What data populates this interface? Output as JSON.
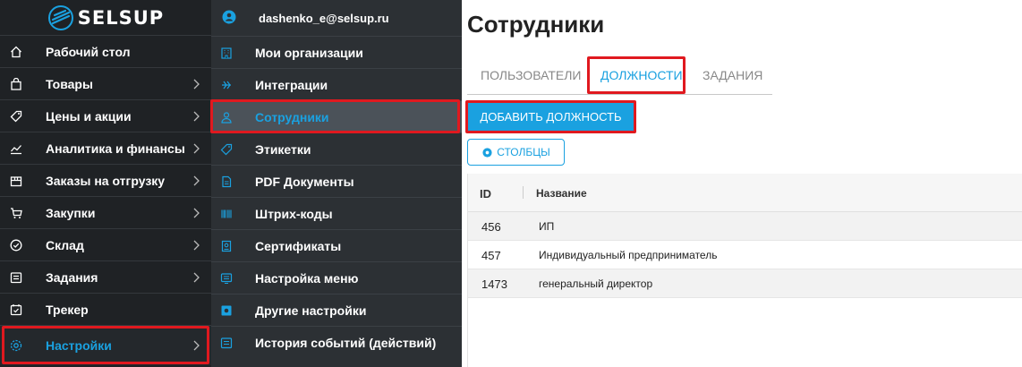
{
  "brand": {
    "name": "SELSUP",
    "accent": "#1aa1e0",
    "highlight": "#e0191f"
  },
  "sidebar": {
    "items": [
      {
        "label": "Рабочий стол",
        "icon": "home-icon",
        "chevron": false
      },
      {
        "label": "Товары",
        "icon": "bag-icon",
        "chevron": true
      },
      {
        "label": "Цены и акции",
        "icon": "tag-icon",
        "chevron": true
      },
      {
        "label": "Аналитика и финансы",
        "icon": "chart-icon",
        "chevron": true
      },
      {
        "label": "Заказы на отгрузку",
        "icon": "box-icon",
        "chevron": true
      },
      {
        "label": "Закупки",
        "icon": "cart-icon",
        "chevron": true
      },
      {
        "label": "Склад",
        "icon": "check-circle-icon",
        "chevron": true
      },
      {
        "label": "Задания",
        "icon": "tasks-icon",
        "chevron": true
      },
      {
        "label": "Трекер",
        "icon": "calendar-check-icon",
        "chevron": false
      },
      {
        "label": "Настройки",
        "icon": "gear-icon",
        "chevron": true,
        "active": true
      }
    ]
  },
  "submenu": {
    "user_email": "dashenko_e@selsup.ru",
    "items": [
      {
        "label": "Мои организации",
        "icon": "building-icon"
      },
      {
        "label": "Интеграции",
        "icon": "integration-icon"
      },
      {
        "label": "Сотрудники",
        "icon": "person-icon",
        "active": true
      },
      {
        "label": "Этикетки",
        "icon": "label-icon"
      },
      {
        "label": "PDF Документы",
        "icon": "document-icon"
      },
      {
        "label": "Штрих-коды",
        "icon": "barcode-icon"
      },
      {
        "label": "Сертификаты",
        "icon": "certificate-icon"
      },
      {
        "label": "Настройка меню",
        "icon": "menu-settings-icon"
      },
      {
        "label": "Другие настройки",
        "icon": "settings-square-icon"
      },
      {
        "label": "История событий (действий)",
        "icon": "history-icon"
      }
    ]
  },
  "main": {
    "title": "Сотрудники",
    "tabs": [
      {
        "label": "ПОЛЬЗОВАТЕЛИ",
        "active": false
      },
      {
        "label": "ДОЛЖНОСТИ",
        "active": true
      },
      {
        "label": "ЗАДАНИЯ",
        "active": false
      }
    ],
    "add_button_label": "ДОБАВИТЬ ДОЛЖНОСТЬ",
    "columns_button_label": "СТОЛБЦЫ",
    "table": {
      "headers": [
        "ID",
        "Название"
      ],
      "rows": [
        [
          "456",
          "ИП"
        ],
        [
          "457",
          "Индивидуальный предприниматель"
        ],
        [
          "1473",
          "генеральный директор"
        ]
      ]
    }
  }
}
